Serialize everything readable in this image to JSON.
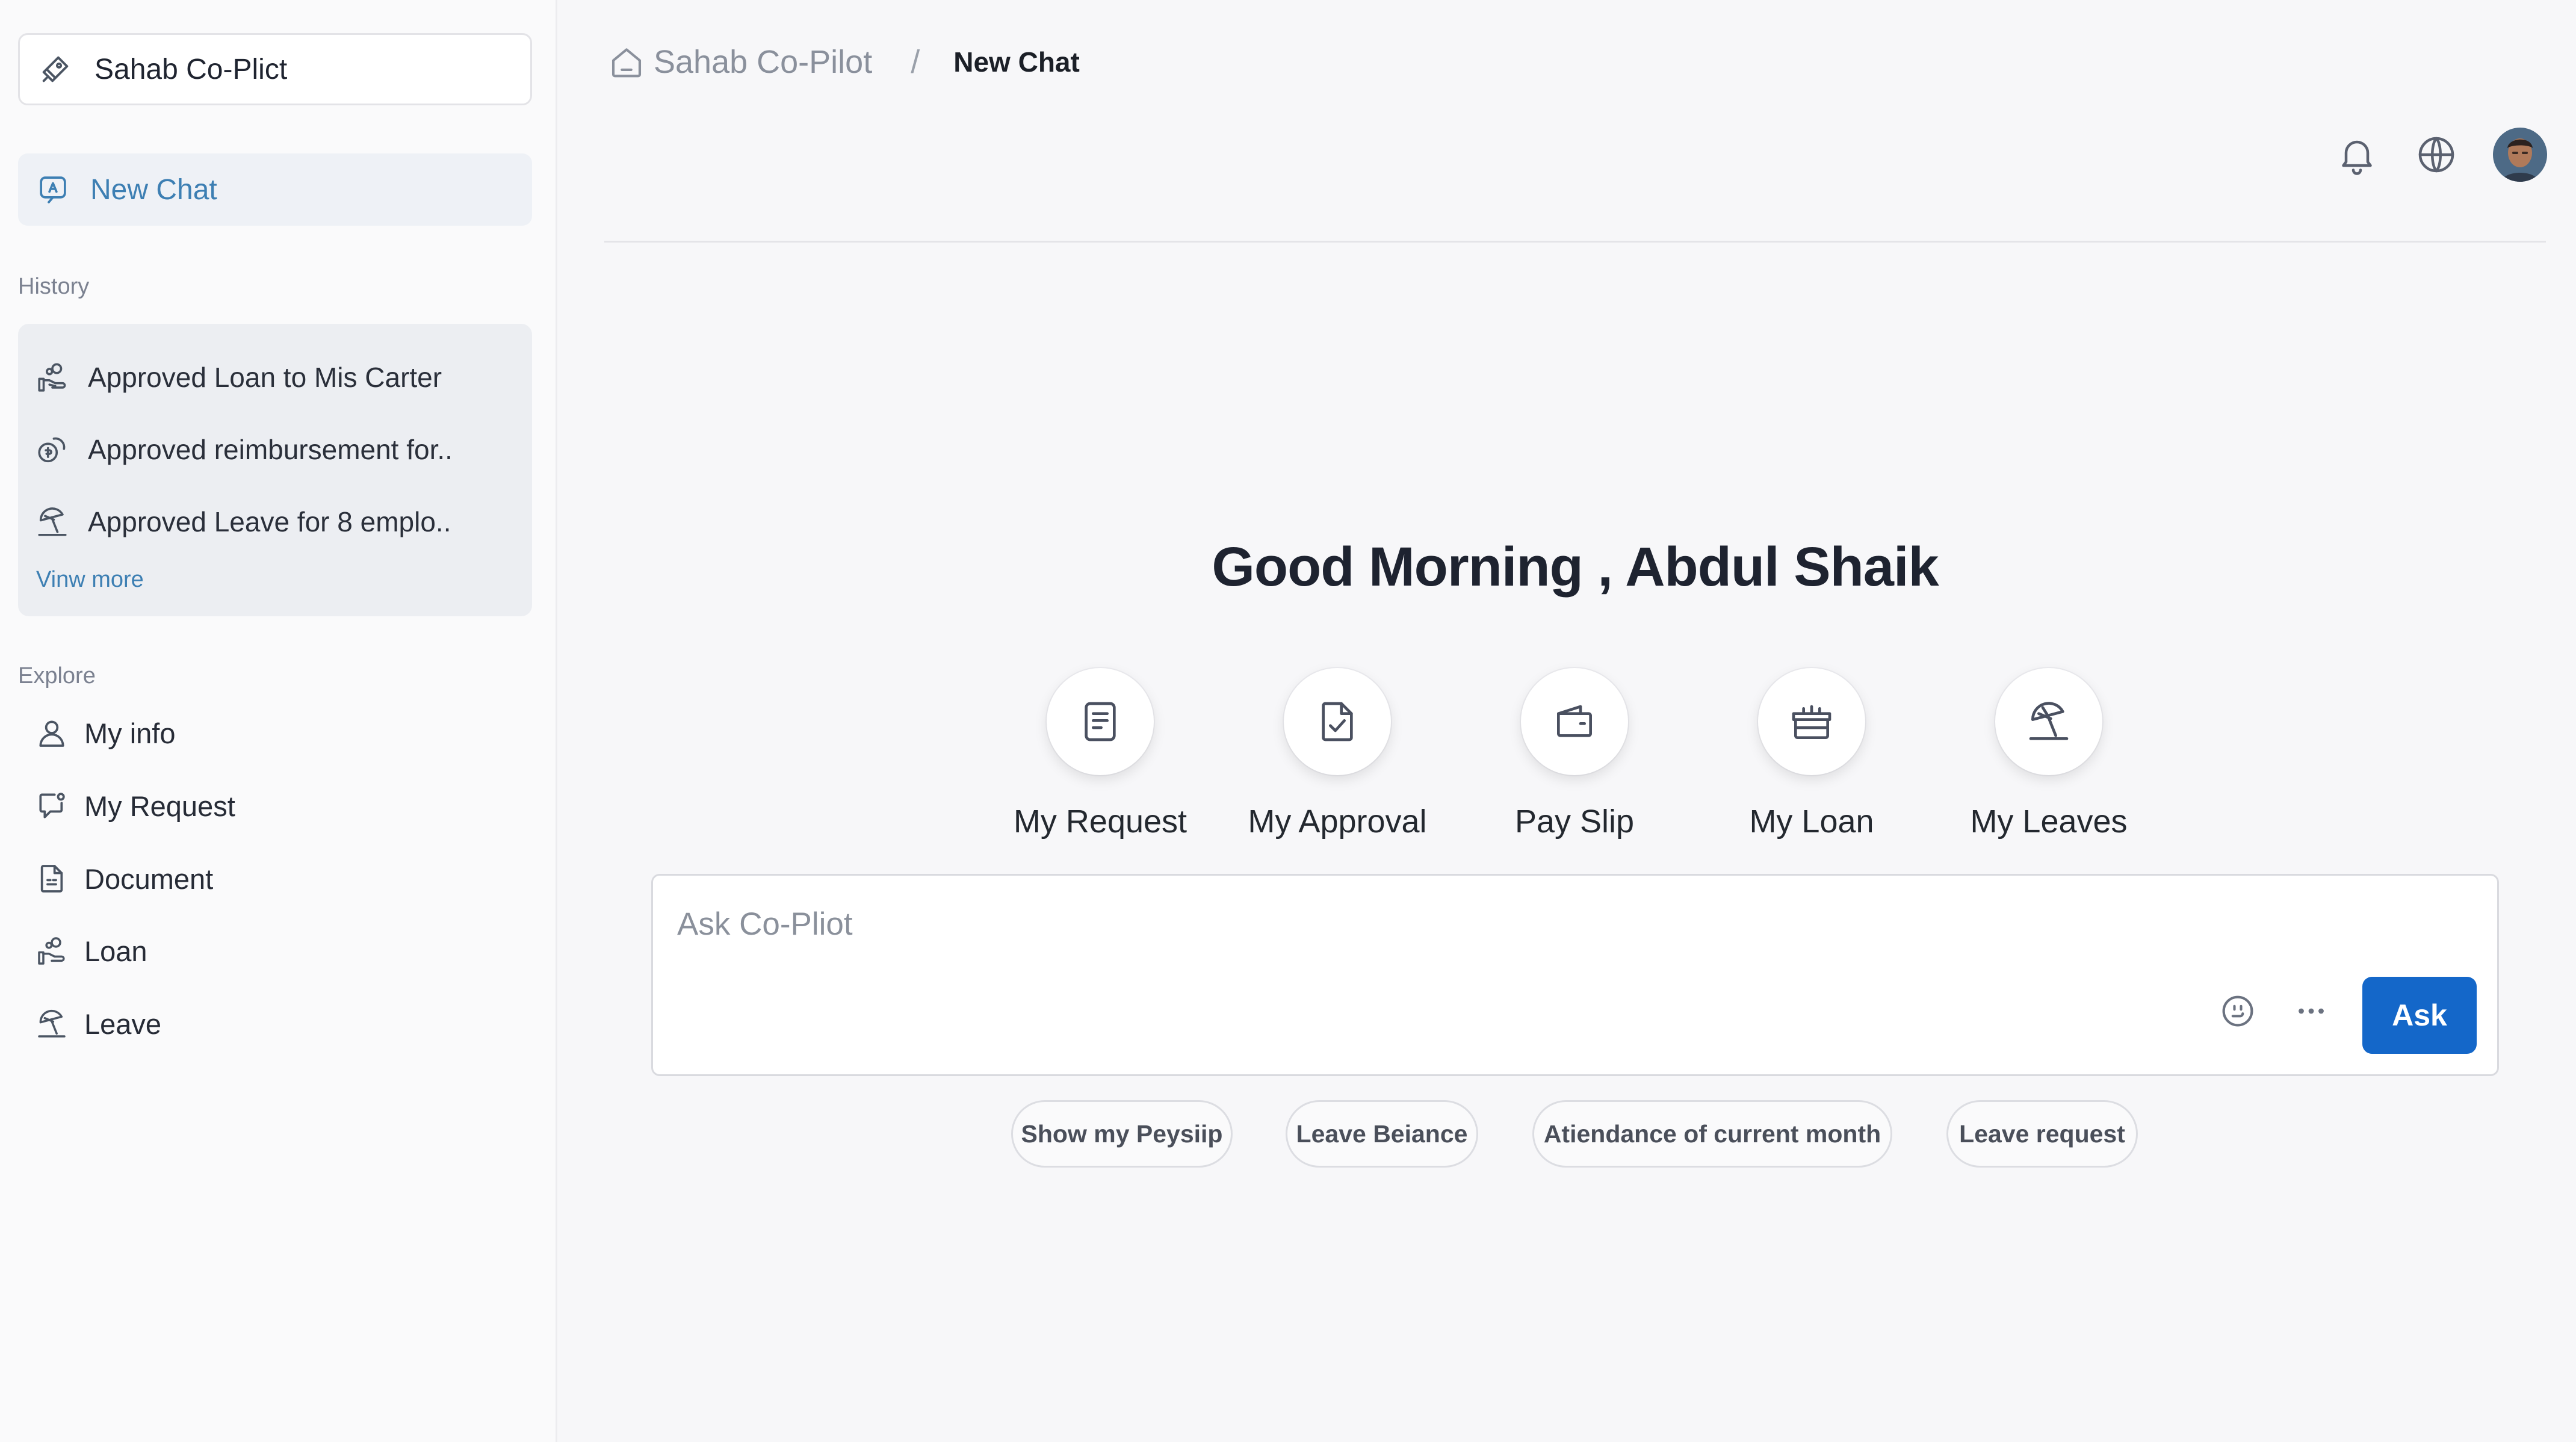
{
  "sidebar": {
    "workspace_name": "Sahab Co-Plict",
    "new_chat_label": "New Chat",
    "history_label": "History",
    "history": [
      {
        "label": "Approved Loan to Mis Carter",
        "icon": "loan-hand-icon"
      },
      {
        "label": "Approved reimbursement for..",
        "icon": "coins-icon"
      },
      {
        "label": "Approved Leave for 8 emplo..",
        "icon": "beach-umbrella-icon"
      }
    ],
    "view_more_label": "Vinw more",
    "explore_label": "Explore",
    "explore": [
      {
        "label": "My info",
        "icon": "user-icon"
      },
      {
        "label": "My Request",
        "icon": "request-icon"
      },
      {
        "label": "Document",
        "icon": "document-icon"
      },
      {
        "label": "Loan",
        "icon": "loan-hand-icon"
      },
      {
        "label": "Leave",
        "icon": "beach-umbrella-icon"
      }
    ]
  },
  "header": {
    "breadcrumb_root": "Sahab Co-Pilot",
    "breadcrumb_separator": "/",
    "breadcrumb_current": "New Chat",
    "icons": [
      "bell-icon",
      "globe-icon",
      "avatar"
    ]
  },
  "main": {
    "greeting": "Good Morning , Abdul Shaik",
    "quick_actions": [
      {
        "label": "My Request",
        "icon": "request-doc-icon"
      },
      {
        "label": "My Approval",
        "icon": "approval-doc-icon"
      },
      {
        "label": "Pay Slip",
        "icon": "wallet-icon"
      },
      {
        "label": "My Loan",
        "icon": "loan-bag-icon"
      },
      {
        "label": "My Leaves",
        "icon": "beach-umbrella-icon"
      }
    ],
    "ask": {
      "placeholder": "Ask Co-Pliot",
      "button_label": "Ask"
    },
    "suggestions": [
      "Show my Peysiip",
      "Leave Beiance",
      "Atiendance of current month",
      "Leave request"
    ]
  },
  "colors": {
    "accent": "#1467c9",
    "link": "#3d7fb3",
    "sidebar_bg": "#fafafb",
    "page_bg": "#f7f7f9"
  }
}
